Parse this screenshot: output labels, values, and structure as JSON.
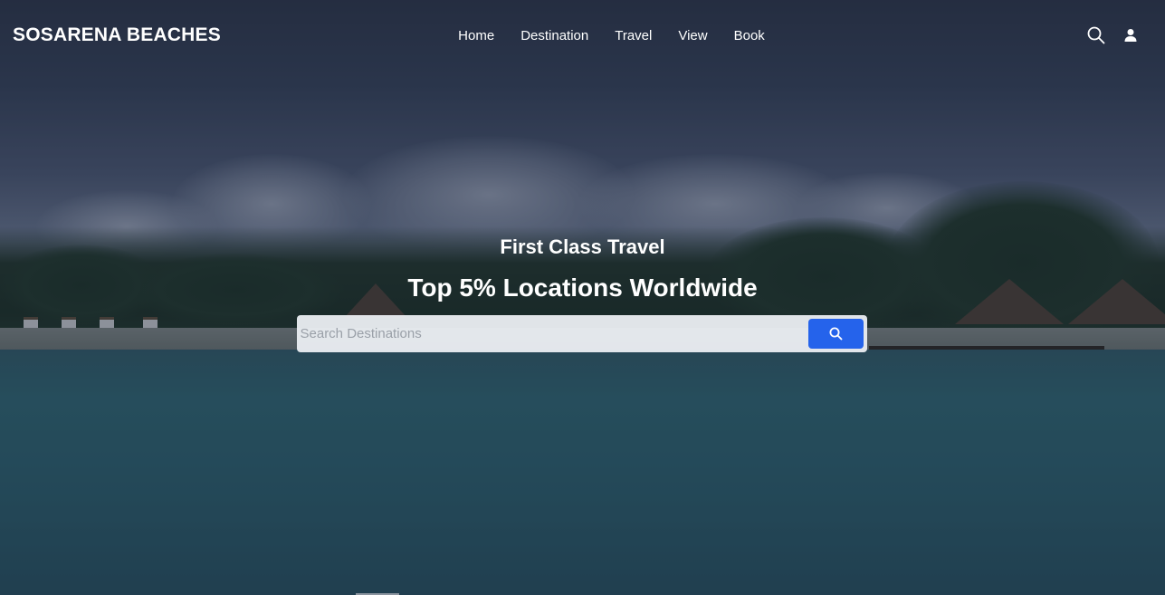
{
  "brand": {
    "name": "SOSARENA BEACHES"
  },
  "nav": {
    "items": [
      {
        "label": "Home"
      },
      {
        "label": "Destination"
      },
      {
        "label": "Travel"
      },
      {
        "label": "View"
      },
      {
        "label": "Book"
      }
    ]
  },
  "icons": {
    "search": "search-icon",
    "user": "user-icon"
  },
  "hero": {
    "subtitle": "First Class Travel",
    "headline": "Top 5% Locations Worldwide"
  },
  "search": {
    "placeholder": "Search Destinations",
    "value": ""
  },
  "colors": {
    "accent": "#2563eb",
    "text": "#ffffff"
  }
}
